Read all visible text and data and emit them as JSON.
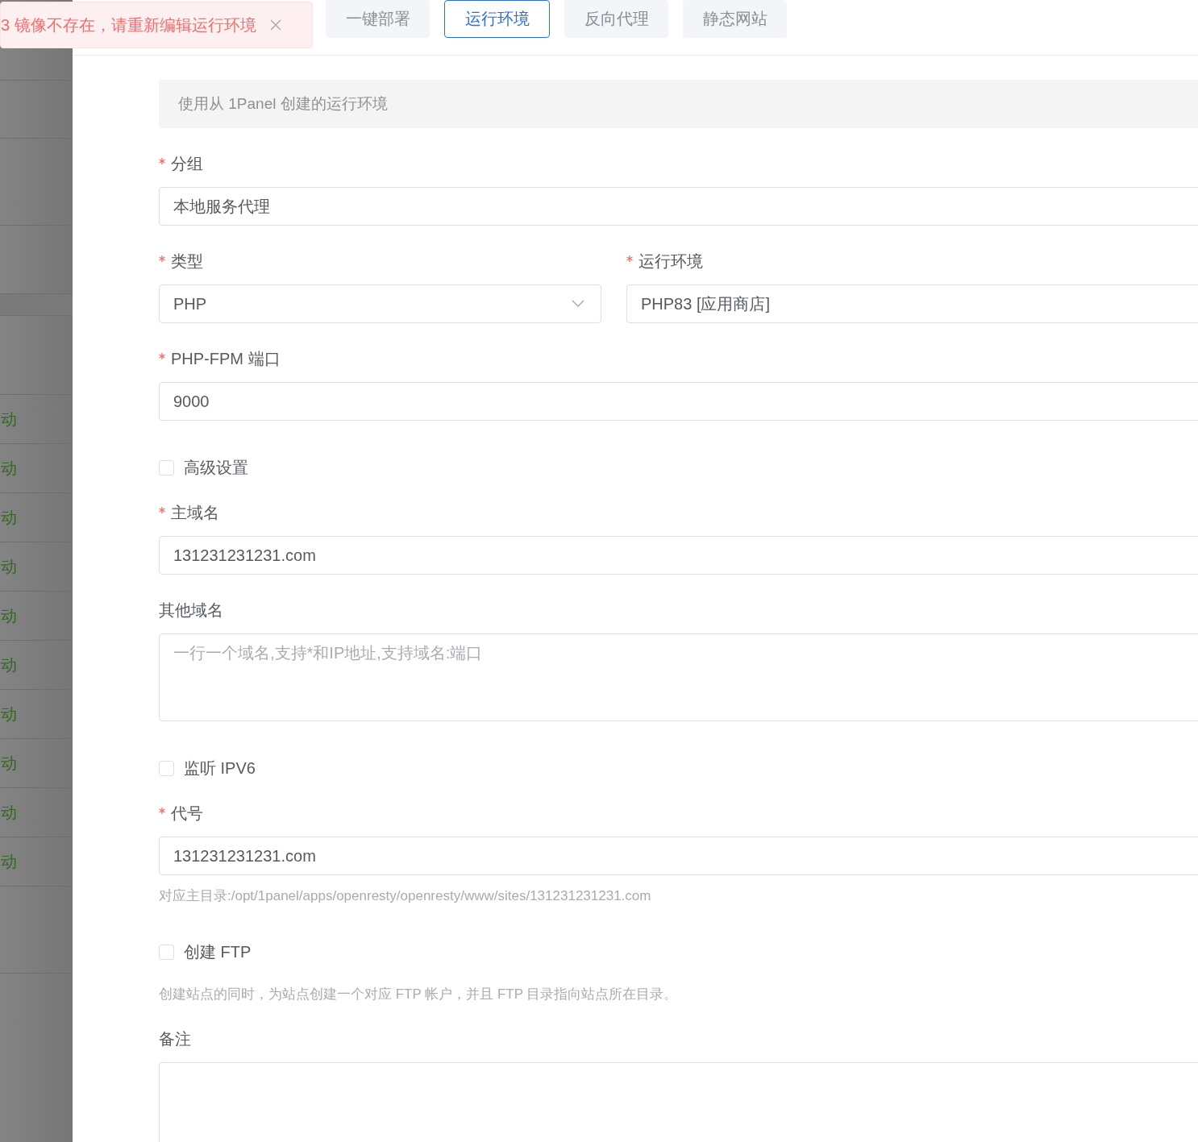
{
  "background_list": {
    "rows": [
      {
        "text": ""
      },
      {
        "text": ""
      },
      {
        "text": ""
      },
      {
        "text": ""
      },
      {
        "text": ""
      },
      {
        "text": ""
      },
      {
        "text": "动"
      },
      {
        "text": "动"
      },
      {
        "text": "动"
      },
      {
        "text": "动"
      },
      {
        "text": "动"
      },
      {
        "text": "动"
      },
      {
        "text": "动"
      },
      {
        "text": "动"
      },
      {
        "text": "动"
      },
      {
        "text": "动"
      },
      {
        "text": ""
      }
    ]
  },
  "toast": {
    "message": "3 镜像不存在，请重新编辑运行环境"
  },
  "tabs": [
    {
      "label": "一键部署",
      "selected": false
    },
    {
      "label": "运行环境",
      "selected": true
    },
    {
      "label": "反向代理",
      "selected": false
    },
    {
      "label": "静态网站",
      "selected": false
    }
  ],
  "info_banner": "使用从 1Panel 创建的运行环境",
  "form": [
    {
      "kind": "field",
      "label": "分组",
      "required": true,
      "input": {
        "kind": "text",
        "value": "本地服务代理"
      }
    },
    {
      "kind": "pair",
      "fields": [
        {
          "label": "类型",
          "required": true,
          "input": {
            "kind": "select",
            "value": "PHP"
          }
        },
        {
          "label": "运行环境",
          "required": true,
          "input": {
            "kind": "text",
            "value": "PHP83 [应用商店]"
          }
        }
      ]
    },
    {
      "kind": "field",
      "label": "PHP-FPM 端口",
      "required": true,
      "input": {
        "kind": "text",
        "value": "9000"
      }
    },
    {
      "kind": "checkbox",
      "label": "高级设置",
      "checked": false
    },
    {
      "kind": "field",
      "label": "主域名",
      "required": true,
      "input": {
        "kind": "text",
        "value": "131231231231.com"
      }
    },
    {
      "kind": "field",
      "label": "其他域名",
      "required": false,
      "input": {
        "kind": "textarea",
        "placeholder": "一行一个域名,支持*和IP地址,支持域名:端口"
      }
    },
    {
      "kind": "checkbox",
      "label": "监听 IPV6",
      "checked": false
    },
    {
      "kind": "field",
      "label": "代号",
      "required": true,
      "input": {
        "kind": "text",
        "value": "131231231231.com"
      },
      "hint": "对应主目录:/opt/1panel/apps/openresty/openresty/www/sites/131231231231.com"
    },
    {
      "kind": "checkbox",
      "label": "创建 FTP",
      "checked": false,
      "hint": "创建站点的同时，为站点创建一个对应 FTP 帐户，并且 FTP 目录指向站点所在目录。"
    },
    {
      "kind": "field",
      "label": "备注",
      "required": false,
      "input": {
        "kind": "textarea"
      }
    }
  ]
}
